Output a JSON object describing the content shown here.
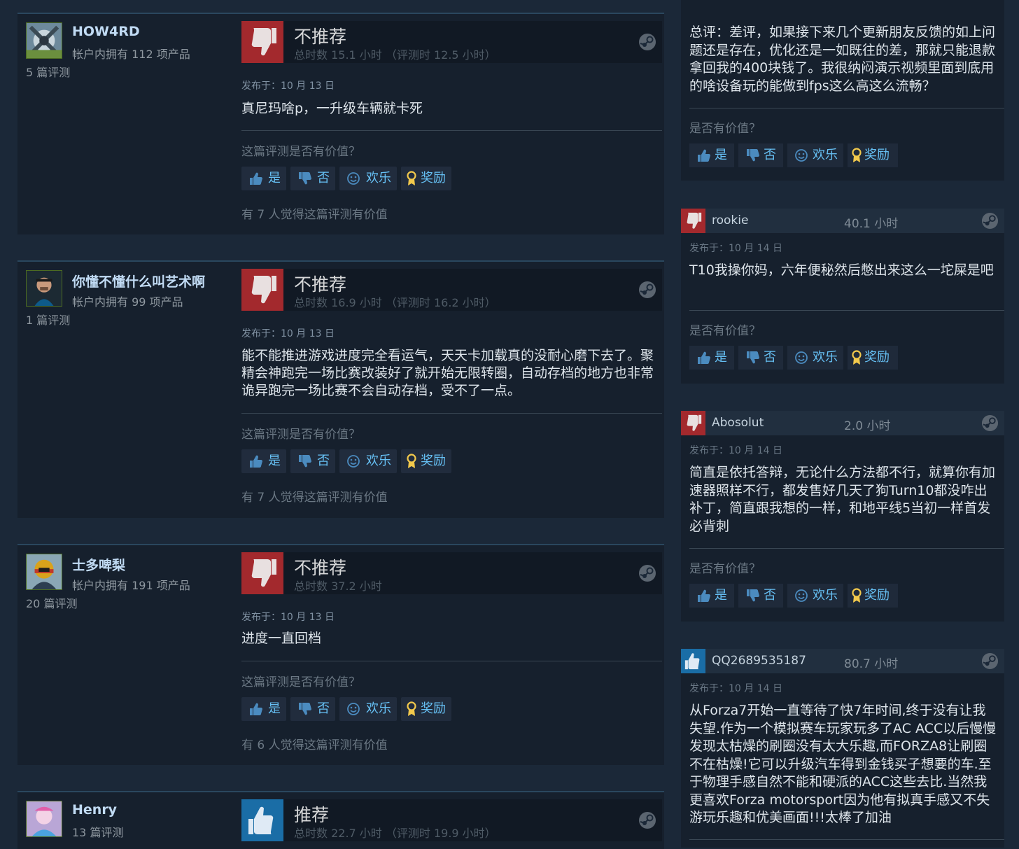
{
  "labels": {
    "posted_prefix": "发布于：",
    "helpful_question": "这篇评测是否有价值？",
    "helpful_question_short": "是否有价值？",
    "vote_yes": "是",
    "vote_no": "否",
    "vote_funny": "欢乐",
    "vote_award": "奖励"
  },
  "colors": {
    "background": "#1b2838",
    "not_recommended": "#a3292d",
    "recommended": "#1a6da6",
    "link_blue": "#66c0f4"
  },
  "reviews": [
    {
      "author": "HOW4RD",
      "owned": "帐户内拥有 112 项产品",
      "review_count": "5 篇评测",
      "verdict": "不推荐",
      "verdict_icon": "thumbs-down-icon",
      "hours": "总时数 15.1 小时 （评测时 12.5 小时）",
      "posted": "发布于：10 月 13 日",
      "text": "真尼玛啥p，一升级车辆就卡死",
      "found_helpful": "有 7 人觉得这篇评测有价值"
    },
    {
      "author": "你懂不懂什么叫艺术啊",
      "owned": "帐户内拥有 99 项产品",
      "review_count": "1 篇评测",
      "verdict": "不推荐",
      "verdict_icon": "thumbs-down-icon",
      "hours": "总时数 16.9 小时 （评测时 16.2 小时）",
      "posted": "发布于：10 月 13 日",
      "text": "能不能推进游戏进度完全看运气，天天卡加载真的没耐心磨下去了。聚精会神跑完一场比赛改装好了就开始无限转圈，自动存档的地方也非常诡异跑完一场比赛不会自动存档，受不了一点。",
      "found_helpful": "有 7 人觉得这篇评测有价值"
    },
    {
      "author": "士多啤梨",
      "owned": "帐户内拥有 191 项产品",
      "review_count": "20 篇评测",
      "verdict": "不推荐",
      "verdict_icon": "thumbs-down-icon",
      "hours": "总时数 37.2 小时",
      "posted": "发布于：10 月 13 日",
      "text": "进度一直回档",
      "found_helpful": "有 6 人觉得这篇评测有价值"
    },
    {
      "author": "Henry",
      "review_count": "13 篇评测",
      "verdict": "推荐",
      "verdict_icon": "thumbs-up-icon",
      "hours": "总时数 22.7 小时 （评测时 19.9 小时）"
    }
  ],
  "side_reviews": [
    {
      "text": "总评：差评，如果接下来几个更新朋友反馈的如上问题还是存在，优化还是一如既往的差，那就只能退款拿回我的400块钱了。我很纳闷演示视频里面到底用的啥设备玩的能做到fps这么高这么流畅？"
    },
    {
      "author": "rookie",
      "hours": "40.1 小时",
      "verdict_icon": "thumbs-down-icon",
      "posted": "发布于：10 月 14 日",
      "text": "T10我操你妈，六年便秘然后憋出来这么一坨屎是吧"
    },
    {
      "author": "Abosolut",
      "hours": "2.0 小时",
      "verdict_icon": "thumbs-down-icon",
      "posted": "发布于：10 月 14 日",
      "text": "简直是依托答辩，无论什么方法都不行，就算你有加速器照样不行，都发售好几天了狗Turn10都没咋出补丁，简直跟我想的一样，和地平线5当初一样首发必背刺"
    },
    {
      "author": "QQ2689535187",
      "hours": "80.7 小时",
      "verdict_icon": "thumbs-up-icon",
      "posted": "发布于：10 月 14 日",
      "text": "从Forza7开始一直等待了快7年时间,终于没有让我失望.作为一个模拟赛车玩家玩多了AC ACC以后慢慢发现太枯燥的刷圈没有太大乐趣,而FORZA8让刷圈不在枯燥!它可以升级汽车得到金钱买子想要的车.至于物理手感自然不能和硬派的ACC这些去比.当然我更喜欢Forza motorsport因为他有拟真手感又不失游玩乐趣和优美画面!!!太棒了加油"
    }
  ]
}
